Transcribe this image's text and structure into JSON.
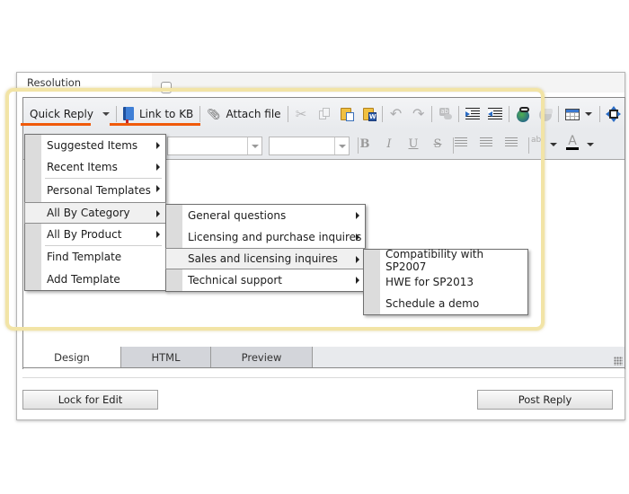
{
  "field": {
    "label": "Resolution"
  },
  "toolbar": {
    "quick_reply": "Quick Reply",
    "link_to_kb": "Link to KB",
    "attach_file": "Attach file",
    "icons": [
      "cut-icon",
      "copy-icon",
      "paste-icon",
      "paste-from-word-icon",
      "undo-icon",
      "redo-icon",
      "spellcheck-icon",
      "indent-icon",
      "outdent-icon",
      "hyperlink-icon",
      "remove-link-icon",
      "table-icon",
      "toggle-fullscreen-icon"
    ]
  },
  "format_toolbar": {
    "font_name": "",
    "font_size": "",
    "bold": "B",
    "italic": "I",
    "underline": "U",
    "strike": "S",
    "font_color_letter": "A",
    "highlight_letter": "ab"
  },
  "quick_reply_menu": {
    "items": [
      {
        "label": "Suggested Items",
        "submenu": true
      },
      {
        "label": "Recent Items",
        "submenu": true
      },
      {
        "label": "Personal Templates",
        "submenu": true
      },
      {
        "label": "All By Category",
        "submenu": true,
        "active": true
      },
      {
        "label": "All By Product",
        "submenu": true
      },
      {
        "label": "Find Template",
        "submenu": false
      },
      {
        "label": "Add Template",
        "submenu": false
      }
    ]
  },
  "category_menu": {
    "items": [
      {
        "label": "General questions",
        "submenu": true
      },
      {
        "label": "Licensing and purchase inquires",
        "submenu": true
      },
      {
        "label": "Sales and licensing inquires",
        "submenu": true,
        "active": true
      },
      {
        "label": "Technical support",
        "submenu": true
      }
    ]
  },
  "sales_menu": {
    "items": [
      {
        "label": "Compatibility with SP2007"
      },
      {
        "label": "HWE for SP2013"
      },
      {
        "label": "Schedule a demo"
      }
    ]
  },
  "tabs": {
    "design": "Design",
    "html": "HTML",
    "preview": "Preview",
    "active": "Design"
  },
  "buttons": {
    "lock_for_edit": "Lock for Edit",
    "post_reply": "Post Reply"
  },
  "colors": {
    "highlight_underline": "#f05a0a",
    "callout_frame": "#f2e4a6"
  }
}
